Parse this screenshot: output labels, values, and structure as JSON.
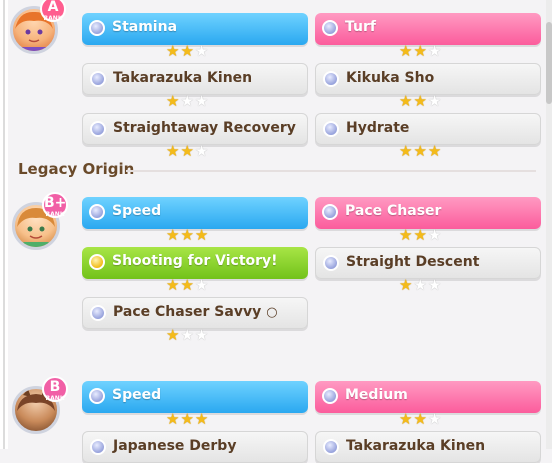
{
  "groups": [
    {
      "rank": {
        "letter": "A",
        "sub": "RANK"
      },
      "cards": [
        {
          "label": "Stamina",
          "style": "blue",
          "stars": 2
        },
        {
          "label": "Turf",
          "style": "pink",
          "stars": 2
        },
        {
          "label": "Takarazuka Kinen",
          "style": "gray",
          "stars": 1
        },
        {
          "label": "Kikuka Sho",
          "style": "gray",
          "stars": 2
        },
        {
          "label": "Straightaway Recovery",
          "style": "gray",
          "stars": 2
        },
        {
          "label": "Hydrate",
          "style": "gray",
          "stars": 3
        }
      ]
    },
    {
      "rank": {
        "letter": "B+",
        "sub": "RANK"
      },
      "cards": [
        {
          "label": "Speed",
          "style": "blue",
          "stars": 3
        },
        {
          "label": "Pace Chaser",
          "style": "pink",
          "stars": 2
        },
        {
          "label": "Shooting for Victory!",
          "style": "green",
          "stars": 2
        },
        {
          "label": "Straight Descent",
          "style": "gray",
          "stars": 1
        },
        {
          "label": "Pace Chaser Savvy",
          "suffix": "○",
          "style": "gray",
          "stars": 1
        }
      ]
    },
    {
      "rank": {
        "letter": "B",
        "sub": "RANK"
      },
      "cards": [
        {
          "label": "Speed",
          "style": "blue",
          "stars": 3
        },
        {
          "label": "Medium",
          "style": "pink",
          "stars": 2
        },
        {
          "label": "Japanese Derby",
          "style": "gray",
          "stars": 0
        },
        {
          "label": "Takarazuka Kinen",
          "style": "gray",
          "stars": 0
        }
      ]
    }
  ],
  "section_title": "Legacy Origin",
  "colors": {
    "blue": "#2aa8f0",
    "pink": "#fb5c9c",
    "green": "#72c21a",
    "gold_star": "#f4bb1a",
    "title_brown": "#6a4a2a"
  },
  "icons": {
    "sparkle": "factor-sparkle-icon",
    "star": "star-icon"
  }
}
